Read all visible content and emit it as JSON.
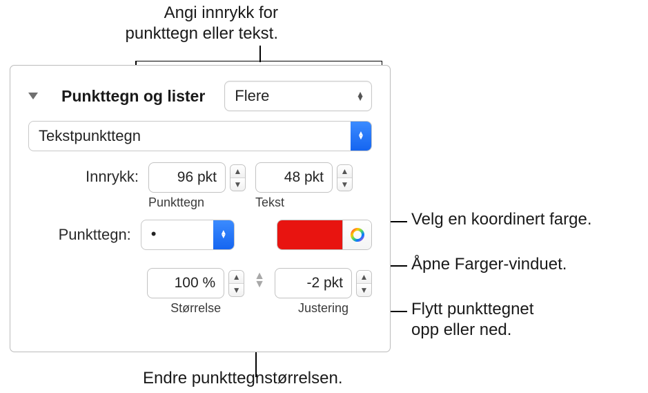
{
  "callouts": {
    "top": "Angi innrykk for\npunkttegn eller tekst.",
    "color_swatch": "Velg en koordinert farge.",
    "color_picker": "Åpne Farger-vinduet.",
    "align": "Flytt punkttegnet\nopp eller ned.",
    "size": "Endre punkttegnstørrelsen."
  },
  "panel": {
    "section_title": "Punkttegn og lister",
    "style_select": "Flere",
    "type_select": "Tekstpunkttegn",
    "indent_label": "Innrykk:",
    "bullet_indent_value": "96 pkt",
    "bullet_indent_caption": "Punkttegn",
    "text_indent_value": "48 pkt",
    "text_indent_caption": "Tekst",
    "bullet_label": "Punkttegn:",
    "bullet_glyph": "•",
    "color_hex": "#e81410",
    "size_value": "100 %",
    "size_caption": "Størrelse",
    "align_value": "-2 pkt",
    "align_caption": "Justering"
  }
}
